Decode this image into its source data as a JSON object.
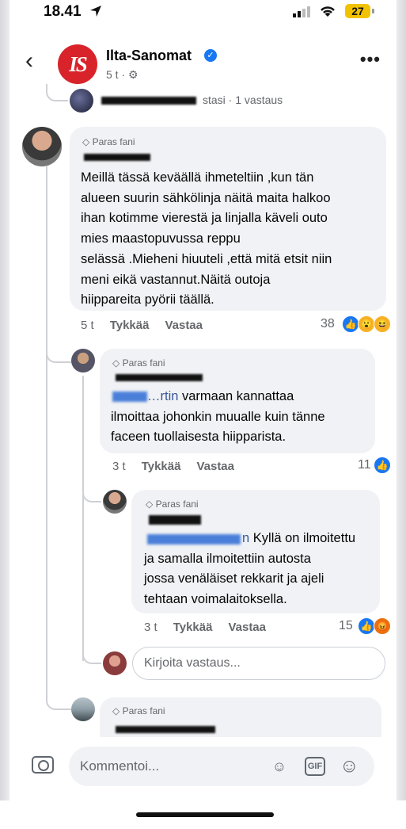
{
  "status_bar": {
    "time": "18.41",
    "battery": "27"
  },
  "header": {
    "page_name": "Ilta-Sanomat",
    "logo_text": "IS",
    "time": "5 t",
    "back_icon": "chevron-left-icon",
    "more_icon": "more-horizontal-icon"
  },
  "prev_reply_line": {
    "text": "stasi · 1 vastaus"
  },
  "comments": [
    {
      "badge": "Paras fani",
      "text": "Meillä tässä keväällä ihmeteltiin ,kun tän alueen suurin sähkölinja näitä maita halkoo ihan kotimme vierestä ja linjalla käveli outo mies maastopuvussa reppu selässä .Mieheni hiuuteli ,että mitä etsit niin meni eikä vastannut.Näitä outoja hiippareita pyörii täällä.",
      "lines": [
        "Meillä tässä keväällä ihmeteltiin ,kun tän",
        "alueen suurin sähkölinja näitä maita halkoo",
        "ihan kotimme vierestä ja linjalla käveli outo",
        "mies maastopuvussa reppu",
        "selässä .Mieheni hiuuteli ,että mitä etsit niin",
        "meni eikä vastannut.Näitä outoja",
        "hiippareita pyörii täällä."
      ],
      "time": "5 t",
      "like": "Tykkää",
      "reply": "Vastaa",
      "reactions": "38"
    },
    {
      "badge": "Paras fani",
      "mention_tail": "…rtin",
      "lines": [
        " varmaan kannattaa",
        "ilmoittaa johonkin muualle kuin tänne",
        "faceen tuollaisesta hiipparista."
      ],
      "time": "3 t",
      "like": "Tykkää",
      "reply": "Vastaa",
      "reactions": "11"
    },
    {
      "badge": "Paras fani",
      "mention_tail": "n",
      "lines": [
        " Kyllä on ilmoitettu",
        "ja samalla ilmoitettiin autosta",
        "jossa venäläiset rekkarit ja ajeli",
        "tehtaan voimalaitoksella."
      ],
      "time": "3 t",
      "like": "Tykkää",
      "reply": "Vastaa",
      "reactions": "15"
    },
    {
      "badge": "Paras fani"
    }
  ],
  "reply_input": {
    "placeholder": "Kirjoita vastaus..."
  },
  "composer": {
    "placeholder": "Kommentoi...",
    "gif_label": "GIF"
  }
}
